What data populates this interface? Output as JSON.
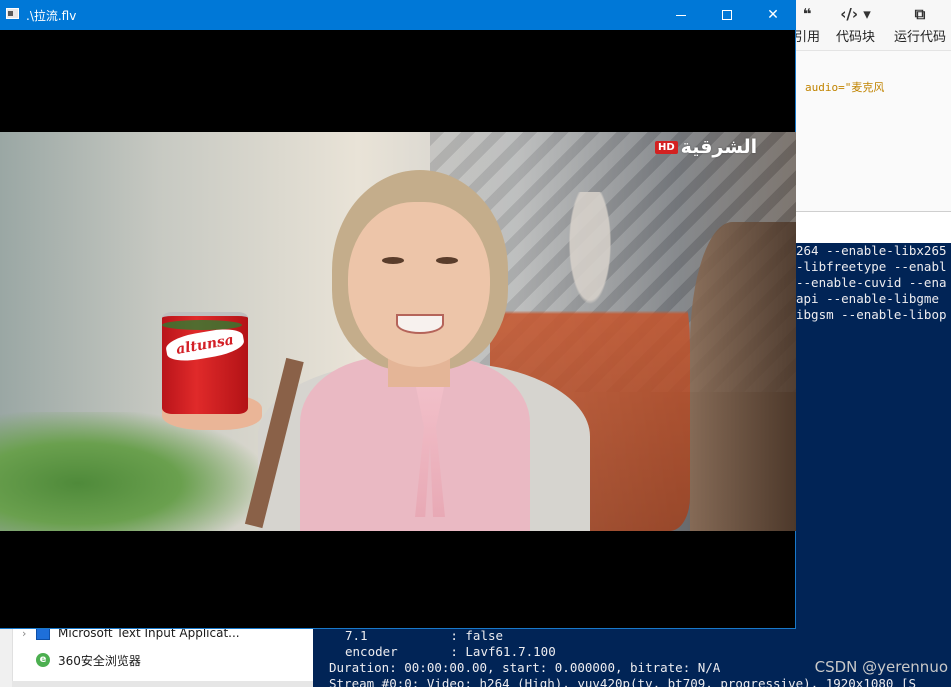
{
  "player": {
    "title": ".\\拉流.flv",
    "channel_badge": "HD",
    "channel_name": "الشرقية",
    "product_brand": "altunsa"
  },
  "editor": {
    "toolbar": [
      {
        "icon": "quote-icon",
        "glyph": "❝",
        "label": "引用"
      },
      {
        "icon": "code-block-icon",
        "glyph": "‹/› ▾",
        "label": "代码块"
      },
      {
        "icon": "run-code-icon",
        "glyph": "⧉",
        "label": "运行代码"
      }
    ],
    "code_line": "audio=\"麦克风"
  },
  "console": {
    "right_lines": [
      "264 --enable-libx265",
      "-libfreetype --enabl",
      "--enable-cuvid --ena",
      "api --enable-libgme",
      "ibgsm --enable-libop"
    ],
    "bottom_lines": [
      "7.1           : false",
      "encoder       : Lavf61.7.100",
      "Duration: 00:00:00.00, start: 0.000000, bitrate: N/A",
      "Stream #0:0: Video: h264 (High), yuv420p(tv, bt709, progressive), 1920x1080 [S"
    ],
    "watermark": "CSDN @yerennuo"
  },
  "explorer": {
    "items": [
      {
        "label": "Microsoft Text Input Applicat...",
        "icon": "app-window-icon",
        "expandable": true
      },
      {
        "label": "360安全浏览器",
        "icon": "browser-360-icon",
        "expandable": false
      }
    ]
  },
  "colors": {
    "titlebar": "#0078d7",
    "console_bg": "#012456",
    "code_string": "#c18401"
  }
}
